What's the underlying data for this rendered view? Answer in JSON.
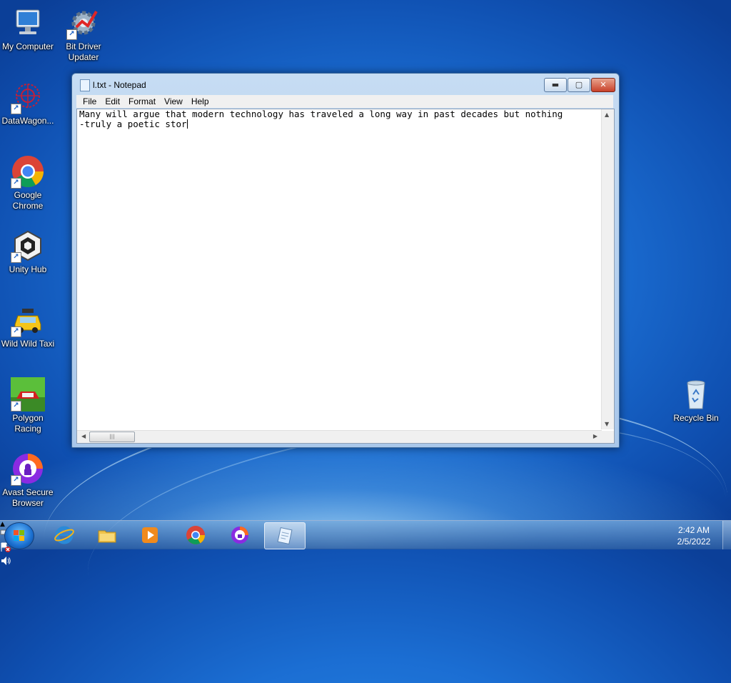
{
  "desktop": {
    "icons": [
      {
        "label": "My Computer"
      },
      {
        "label": "Bit Driver Updater"
      },
      {
        "label": "DataWagon..."
      },
      {
        "label": "Google Chrome"
      },
      {
        "label": "Unity Hub"
      },
      {
        "label": "Wild Wild Taxi"
      },
      {
        "label": "Polygon Racing"
      },
      {
        "label": "Avast Secure Browser"
      },
      {
        "label": "Recycle Bin"
      }
    ]
  },
  "notepad": {
    "title": "l.txt - Notepad",
    "menu": [
      "File",
      "Edit",
      "Format",
      "View",
      "Help"
    ],
    "content_line1": "Many will argue that modern technology has traveled a long way in past decades but nothing",
    "content_line2": "-truly a poetic stor",
    "min_glyph": "▬",
    "max_glyph": "▢",
    "close_glyph": "✕",
    "scroll_thumb_glyph": "|||"
  },
  "taskbar": {
    "clock_time": "2:42 AM",
    "clock_date": "2/5/2022",
    "items": [
      "Internet Explorer",
      "File Explorer",
      "Windows Media Player",
      "Google Chrome",
      "Avast Secure Browser",
      "Notepad"
    ],
    "tray_up": "▲"
  },
  "colors": {
    "accent": "#1b6ed3",
    "close": "#c8412a"
  }
}
